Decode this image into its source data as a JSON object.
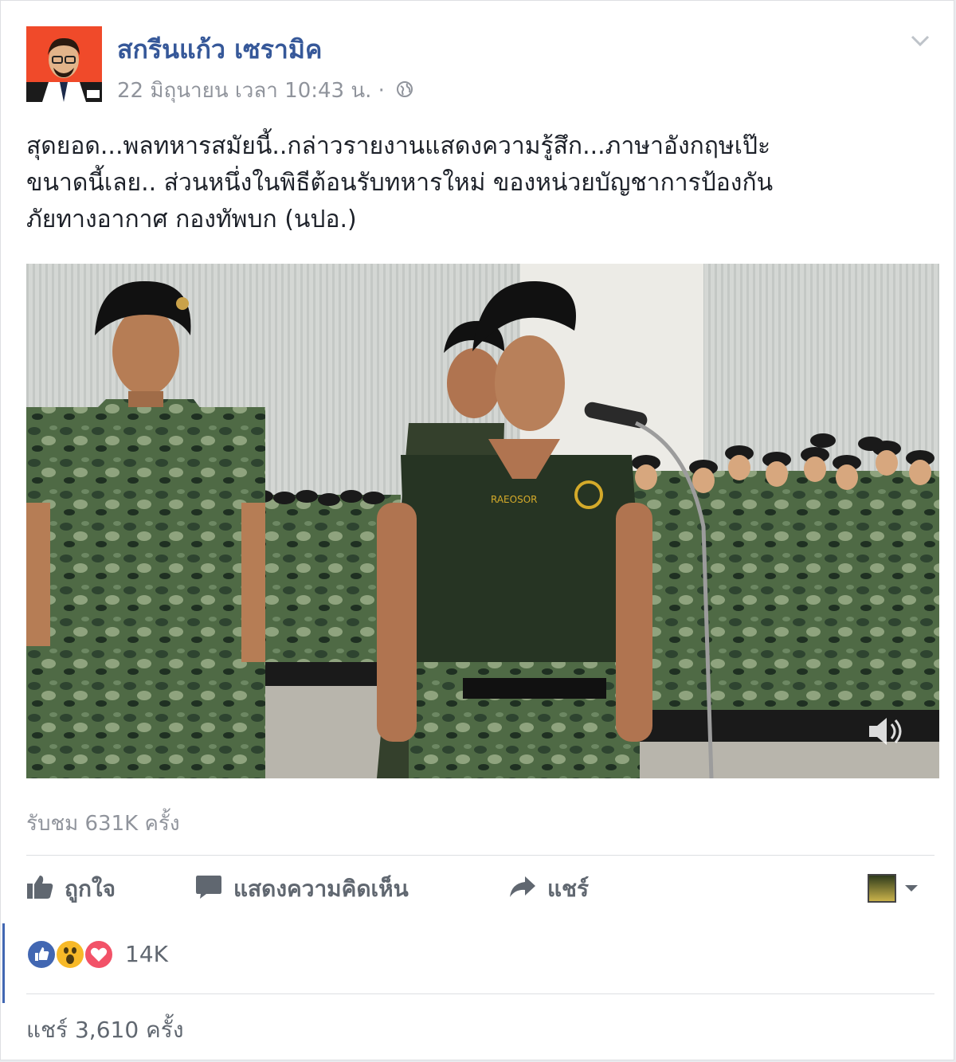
{
  "post": {
    "author": "สกรีนแก้ว เซรามิค",
    "timestamp": "22 มิถุนายน เวลา 10:43 น. ·",
    "privacy_icon": "globe-icon",
    "text_lines": [
      "สุดยอด...พลทหารสมัยนี้..กล่าวรายงานแสดงความรู้สึก...ภาษาอังกฤษเป๊ะ",
      "ขนาดนี้เลย.. ส่วนหนึ่งในพิธีต้อนรับทหารใหม่ ของหน่วยบัญชาการป้องกัน",
      "ภัยทางอากาศ กองทัพบก (นปอ.)"
    ]
  },
  "video": {
    "shirt_text": "RAEOSOR",
    "volume_icon": "speaker-icon"
  },
  "stats": {
    "views": "รับชม 631K ครั้ง",
    "reactions_count": "14K",
    "shares": "แชร์ 3,610 ครั้ง"
  },
  "actions": {
    "like": "ถูกใจ",
    "comment": "แสดงความคิดเห็น",
    "share": "แชร์"
  },
  "colors": {
    "link": "#365899",
    "secondary_text": "#90949c",
    "action_text": "#606770",
    "like_blue": "#4267b2",
    "love_red": "#f25268",
    "wow_yellow": "#f7b928"
  }
}
